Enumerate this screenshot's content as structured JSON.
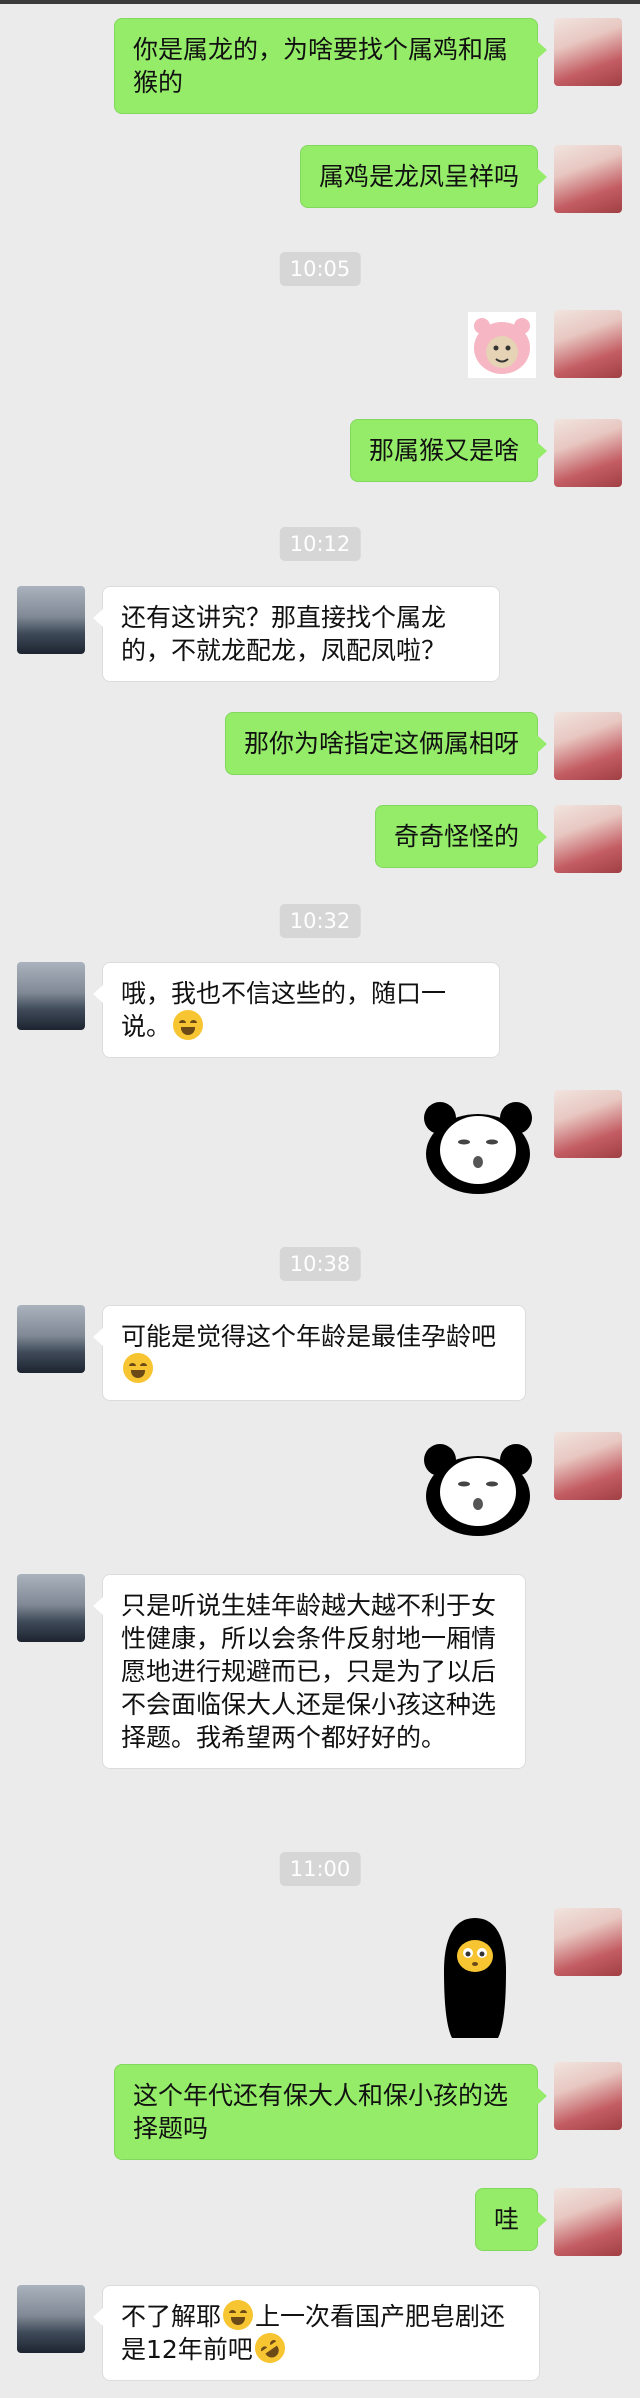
{
  "messages": {
    "m1": {
      "text": "你是属龙的，为啥要找个属鸡和属猴的"
    },
    "m2": {
      "text": "属鸡是龙凤呈祥吗"
    },
    "t1": {
      "text": "10:05"
    },
    "m3": {
      "sticker": "pink-piggy-meme-sticker"
    },
    "m4": {
      "text": "那属猴又是啥"
    },
    "t2": {
      "text": "10:12"
    },
    "m5": {
      "text": "还有这讲究？那直接找个属龙的，不就龙配龙，凤配凤啦？"
    },
    "m6": {
      "text": "那你为啥指定这俩属相呀"
    },
    "m7": {
      "text": "奇奇怪怪的"
    },
    "t3": {
      "text": "10:32"
    },
    "m8": {
      "text": "哦，我也不信这些的，随口一说。"
    },
    "m9": {
      "sticker": "panda-face-meme-sticker"
    },
    "t4": {
      "text": "10:38"
    },
    "m10": {
      "text": "可能是觉得这个年龄是最佳孕龄吧"
    },
    "m11": {
      "sticker": "panda-face-meme-sticker"
    },
    "m12": {
      "text": "只是听说生娃年龄越大越不利于女性健康，所以会条件反射地一厢情愿地进行规避而已，只是为了以后不会面临保大人还是保小孩这种选择题。我希望两个都好好的。"
    },
    "t5": {
      "text": "11:00"
    },
    "m13": {
      "sticker": "black-hooded-figure-sticker"
    },
    "m14": {
      "text": "这个年代还有保大人和保小孩的选择题吗"
    },
    "m15": {
      "text": "哇"
    },
    "m16": {
      "text": "不了解耶"
    },
    "m16b": {
      "text": "上一次看国产肥皂剧还是12年前吧"
    }
  },
  "emoji": {
    "laugh": "tears-of-joy-emoji",
    "rolling": "rolling-laugh-emoji"
  },
  "colors": {
    "background": "#ebebeb",
    "sent_bubble": "#95ec69",
    "received_bubble": "#ffffff",
    "timestamp_bg": "#d6d6d6"
  }
}
